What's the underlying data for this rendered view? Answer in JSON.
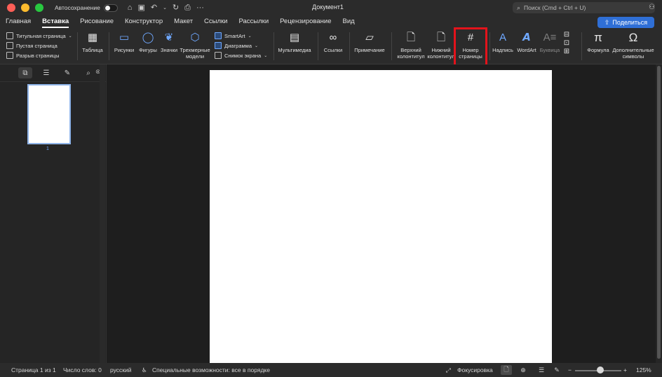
{
  "titlebar": {
    "autosave_label": "Автосохранение",
    "doc_title": "Документ1",
    "search_placeholder": "Поиск (Cmd + Ctrl + U)"
  },
  "tabs": [
    {
      "label": "Главная"
    },
    {
      "label": "Вставка",
      "active": true
    },
    {
      "label": "Рисование"
    },
    {
      "label": "Конструктор"
    },
    {
      "label": "Макет"
    },
    {
      "label": "Ссылки"
    },
    {
      "label": "Рассылки"
    },
    {
      "label": "Рецензирование"
    },
    {
      "label": "Вид"
    }
  ],
  "share_label": "Поделиться",
  "ribbon": {
    "pages": {
      "title_page": "Титульная страница",
      "blank_page": "Пустая страница",
      "page_break": "Разрыв страницы"
    },
    "table": "Таблица",
    "pictures": "Рисунки",
    "shapes": "Фигуры",
    "icons": "Значки",
    "models_line1": "Трехмерные",
    "models_line2": "модели",
    "smartart": "SmartArt",
    "chart": "Диаграмма",
    "screenshot": "Снимок экрана",
    "media": "Мультимедиа",
    "links": "Ссылки",
    "comment": "Примечание",
    "header_line1": "Верхний",
    "header_line2": "колонтитул",
    "footer_line1": "Нижний",
    "footer_line2": "колонтитул",
    "pagenum_line1": "Номер",
    "pagenum_line2": "страницы",
    "textbox": "Надпись",
    "wordart": "WordArt",
    "dropcap": "Буквица",
    "equation": "Формула",
    "symbols_line1": "Дополнительные",
    "symbols_line2": "символы"
  },
  "navpane": {
    "page_number": "1"
  },
  "status": {
    "page": "Страница 1 из 1",
    "words": "Число слов: 0",
    "language": "русский",
    "accessibility": "Специальные возможности: все в порядке",
    "focus": "Фокусировка",
    "zoom": "125%"
  },
  "colors": {
    "accent": "#2f6fd6",
    "highlight": "#e3131b"
  }
}
